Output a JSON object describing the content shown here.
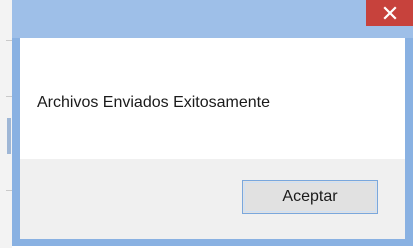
{
  "dialog": {
    "close_icon": "close-icon",
    "message": "Archivos Enviados Exitosamente",
    "ok_label": "Aceptar"
  },
  "colors": {
    "titlebar": "#9ebfe8",
    "frame": "#89b1e2",
    "close_button": "#c7423c",
    "footer": "#f0f0f0",
    "button_border": "#7aa7dc"
  }
}
